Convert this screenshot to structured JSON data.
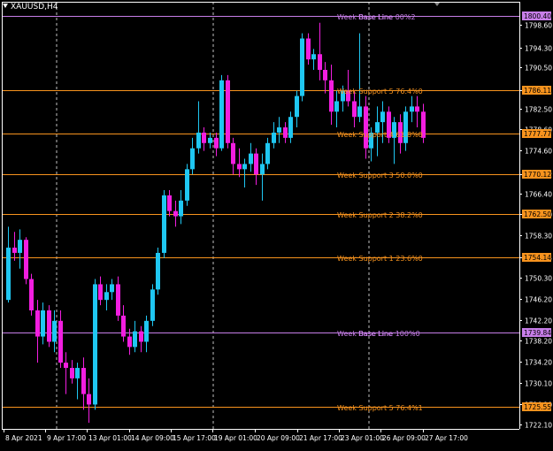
{
  "window": {
    "symbol_label": "XAUUSD,H4"
  },
  "colors": {
    "background": "#000000",
    "bull": "#1fc7f2",
    "bear": "#f21ee0",
    "level_orange": "#f7931e",
    "level_violet": "#c77ee8",
    "axis": "#ffffff",
    "vline": "#c0c0c0"
  },
  "chart_data": {
    "type": "candlestick",
    "ylim": [
      1721,
      1801.5
    ],
    "y_ticks": [
      "1798.60",
      "1794.30",
      "1790.50",
      "1786.11",
      "1782.50",
      "1778.60",
      "1774.60",
      "1770.12",
      "1766.40",
      "1762.50",
      "1758.30",
      "1754.14",
      "1750.30",
      "1746.20",
      "1742.20",
      "1738.20",
      "1734.20",
      "1730.10",
      "1726.10",
      "1722.10"
    ],
    "price_tags": [
      {
        "label": "1800.40",
        "value": 1800.4,
        "color": "#c77ee8",
        "text": "#000000"
      },
      {
        "label": "1786.11",
        "value": 1786.11,
        "color": "#f7931e",
        "text": "#000000"
      },
      {
        "label": "1777.77",
        "value": 1777.77,
        "color": "#f7931e",
        "text": "#000000"
      },
      {
        "label": "1770.12",
        "value": 1770.12,
        "color": "#f7931e",
        "text": "#000000"
      },
      {
        "label": "1762.50",
        "value": 1762.5,
        "color": "#f7931e",
        "text": "#000000"
      },
      {
        "label": "1754.14",
        "value": 1754.14,
        "color": "#f7931e",
        "text": "#000000"
      },
      {
        "label": "1739.84",
        "value": 1739.84,
        "color": "#c77ee8",
        "text": "#000000"
      },
      {
        "label": "1725.55",
        "value": 1725.55,
        "color": "#f7931e",
        "text": "#000000"
      }
    ],
    "x_ticks": [
      "8 Apr 2021",
      "9 Apr 17:00",
      "13 Apr 01:00",
      "14 Apr 09:00",
      "15 Apr 17:00",
      "19 Apr 01:00",
      "20 Apr 09:00",
      "21 Apr 17:00",
      "23 Apr 01:00",
      "26 Apr 09:00",
      "27 Apr 17:00"
    ],
    "levels": [
      {
        "label": "Week Base Line 00%2",
        "value": 1800.4,
        "color": "#c77ee8"
      },
      {
        "label": "Week Support 5 76.4%0",
        "value": 1786.11,
        "color": "#f7931e"
      },
      {
        "label": "Week Support 4 61.8%0",
        "value": 1777.77,
        "color": "#f7931e"
      },
      {
        "label": "Week Support 3 50.0%0",
        "value": 1770.12,
        "color": "#f7931e"
      },
      {
        "label": "Week Support 2 38.2%0",
        "value": 1762.5,
        "color": "#f7931e"
      },
      {
        "label": "Week Support 1 23.6%0",
        "value": 1754.14,
        "color": "#f7931e"
      },
      {
        "label": "Week Base Line 100%0",
        "value": 1739.84,
        "color": "#c77ee8"
      },
      {
        "label": "Week Support 5 76.4%1",
        "value": 1725.55,
        "color": "#f7931e"
      }
    ],
    "candles": [
      {
        "o": 1746.0,
        "h": 1760.0,
        "l": 1745.5,
        "c": 1756.0
      },
      {
        "o": 1756.0,
        "h": 1759.0,
        "l": 1753.5,
        "c": 1755.0
      },
      {
        "o": 1755.0,
        "h": 1759.5,
        "l": 1752.0,
        "c": 1757.5
      },
      {
        "o": 1757.5,
        "h": 1758.0,
        "l": 1749.0,
        "c": 1750.0
      },
      {
        "o": 1750.0,
        "h": 1751.0,
        "l": 1743.0,
        "c": 1744.0
      },
      {
        "o": 1744.0,
        "h": 1746.0,
        "l": 1734.0,
        "c": 1739.0
      },
      {
        "o": 1739.0,
        "h": 1745.5,
        "l": 1737.5,
        "c": 1744.0
      },
      {
        "o": 1744.0,
        "h": 1745.0,
        "l": 1737.0,
        "c": 1738.0
      },
      {
        "o": 1738.0,
        "h": 1744.0,
        "l": 1736.0,
        "c": 1742.0
      },
      {
        "o": 1742.0,
        "h": 1744.0,
        "l": 1733.0,
        "c": 1734.0
      },
      {
        "o": 1734.0,
        "h": 1736.0,
        "l": 1728.0,
        "c": 1733.0
      },
      {
        "o": 1733.0,
        "h": 1734.5,
        "l": 1730.0,
        "c": 1731.0
      },
      {
        "o": 1731.0,
        "h": 1734.0,
        "l": 1727.0,
        "c": 1733.0
      },
      {
        "o": 1733.0,
        "h": 1735.0,
        "l": 1725.0,
        "c": 1728.0
      },
      {
        "o": 1728.0,
        "h": 1731.0,
        "l": 1722.5,
        "c": 1726.0
      },
      {
        "o": 1726.0,
        "h": 1750.0,
        "l": 1725.0,
        "c": 1749.0
      },
      {
        "o": 1749.0,
        "h": 1750.5,
        "l": 1745.0,
        "c": 1746.0
      },
      {
        "o": 1746.0,
        "h": 1749.0,
        "l": 1744.0,
        "c": 1747.5
      },
      {
        "o": 1747.5,
        "h": 1750.0,
        "l": 1746.0,
        "c": 1749.0
      },
      {
        "o": 1749.0,
        "h": 1750.5,
        "l": 1742.0,
        "c": 1743.0
      },
      {
        "o": 1743.0,
        "h": 1745.0,
        "l": 1738.0,
        "c": 1739.0
      },
      {
        "o": 1739.0,
        "h": 1740.5,
        "l": 1735.5,
        "c": 1737.0
      },
      {
        "o": 1737.0,
        "h": 1742.0,
        "l": 1736.0,
        "c": 1740.0
      },
      {
        "o": 1740.0,
        "h": 1741.0,
        "l": 1736.0,
        "c": 1738.0
      },
      {
        "o": 1738.0,
        "h": 1743.0,
        "l": 1736.0,
        "c": 1742.0
      },
      {
        "o": 1742.0,
        "h": 1749.0,
        "l": 1741.0,
        "c": 1748.0
      },
      {
        "o": 1748.0,
        "h": 1756.0,
        "l": 1747.0,
        "c": 1755.0
      },
      {
        "o": 1755.0,
        "h": 1767.0,
        "l": 1754.0,
        "c": 1766.0
      },
      {
        "o": 1766.0,
        "h": 1767.0,
        "l": 1762.0,
        "c": 1763.0
      },
      {
        "o": 1763.0,
        "h": 1765.0,
        "l": 1760.0,
        "c": 1762.0
      },
      {
        "o": 1762.0,
        "h": 1767.0,
        "l": 1760.5,
        "c": 1765.0
      },
      {
        "o": 1765.0,
        "h": 1772.0,
        "l": 1764.0,
        "c": 1771.0
      },
      {
        "o": 1771.0,
        "h": 1777.0,
        "l": 1770.0,
        "c": 1775.0
      },
      {
        "o": 1775.0,
        "h": 1784.0,
        "l": 1774.0,
        "c": 1778.0
      },
      {
        "o": 1778.0,
        "h": 1779.0,
        "l": 1774.5,
        "c": 1776.0
      },
      {
        "o": 1776.0,
        "h": 1778.0,
        "l": 1775.0,
        "c": 1777.0
      },
      {
        "o": 1777.0,
        "h": 1778.0,
        "l": 1773.5,
        "c": 1775.0
      },
      {
        "o": 1775.0,
        "h": 1789.0,
        "l": 1774.5,
        "c": 1788.0
      },
      {
        "o": 1788.0,
        "h": 1789.0,
        "l": 1775.0,
        "c": 1776.0
      },
      {
        "o": 1776.0,
        "h": 1777.0,
        "l": 1770.0,
        "c": 1772.0
      },
      {
        "o": 1772.0,
        "h": 1775.0,
        "l": 1769.5,
        "c": 1771.0
      },
      {
        "o": 1771.0,
        "h": 1773.0,
        "l": 1767.5,
        "c": 1772.0
      },
      {
        "o": 1772.0,
        "h": 1776.0,
        "l": 1770.5,
        "c": 1774.0
      },
      {
        "o": 1774.0,
        "h": 1775.0,
        "l": 1768.0,
        "c": 1770.0
      },
      {
        "o": 1770.0,
        "h": 1774.0,
        "l": 1765.0,
        "c": 1772.0
      },
      {
        "o": 1772.0,
        "h": 1777.0,
        "l": 1771.0,
        "c": 1776.0
      },
      {
        "o": 1776.0,
        "h": 1780.0,
        "l": 1775.0,
        "c": 1778.0
      },
      {
        "o": 1778.0,
        "h": 1781.0,
        "l": 1776.0,
        "c": 1779.0
      },
      {
        "o": 1779.0,
        "h": 1780.0,
        "l": 1776.0,
        "c": 1777.0
      },
      {
        "o": 1777.0,
        "h": 1782.0,
        "l": 1776.0,
        "c": 1781.0
      },
      {
        "o": 1781.0,
        "h": 1786.0,
        "l": 1779.0,
        "c": 1785.0
      },
      {
        "o": 1785.0,
        "h": 1797.0,
        "l": 1784.0,
        "c": 1796.0
      },
      {
        "o": 1796.0,
        "h": 1797.0,
        "l": 1791.0,
        "c": 1792.0
      },
      {
        "o": 1792.0,
        "h": 1794.0,
        "l": 1790.0,
        "c": 1793.0
      },
      {
        "o": 1793.0,
        "h": 1799.0,
        "l": 1788.0,
        "c": 1790.0
      },
      {
        "o": 1790.0,
        "h": 1791.5,
        "l": 1785.5,
        "c": 1788.0
      },
      {
        "o": 1788.0,
        "h": 1791.0,
        "l": 1779.5,
        "c": 1782.0
      },
      {
        "o": 1782.0,
        "h": 1786.0,
        "l": 1779.0,
        "c": 1784.0
      },
      {
        "o": 1784.0,
        "h": 1787.0,
        "l": 1782.0,
        "c": 1786.0
      },
      {
        "o": 1786.0,
        "h": 1790.0,
        "l": 1783.0,
        "c": 1784.0
      },
      {
        "o": 1784.0,
        "h": 1786.0,
        "l": 1779.0,
        "c": 1781.0
      },
      {
        "o": 1781.0,
        "h": 1797.0,
        "l": 1780.0,
        "c": 1783.0
      },
      {
        "o": 1783.0,
        "h": 1785.0,
        "l": 1773.0,
        "c": 1775.0
      },
      {
        "o": 1775.0,
        "h": 1779.0,
        "l": 1772.5,
        "c": 1778.0
      },
      {
        "o": 1778.0,
        "h": 1783.0,
        "l": 1773.5,
        "c": 1780.0
      },
      {
        "o": 1780.0,
        "h": 1784.0,
        "l": 1776.0,
        "c": 1782.0
      },
      {
        "o": 1782.0,
        "h": 1783.0,
        "l": 1776.0,
        "c": 1777.0
      },
      {
        "o": 1777.0,
        "h": 1781.0,
        "l": 1772.0,
        "c": 1780.0
      },
      {
        "o": 1780.0,
        "h": 1781.5,
        "l": 1774.0,
        "c": 1776.0
      },
      {
        "o": 1776.0,
        "h": 1783.0,
        "l": 1774.5,
        "c": 1782.0
      },
      {
        "o": 1782.0,
        "h": 1785.0,
        "l": 1780.0,
        "c": 1783.0
      },
      {
        "o": 1783.0,
        "h": 1785.0,
        "l": 1779.0,
        "c": 1782.0
      },
      {
        "o": 1782.0,
        "h": 1783.5,
        "l": 1776.0,
        "c": 1777.0
      }
    ]
  }
}
